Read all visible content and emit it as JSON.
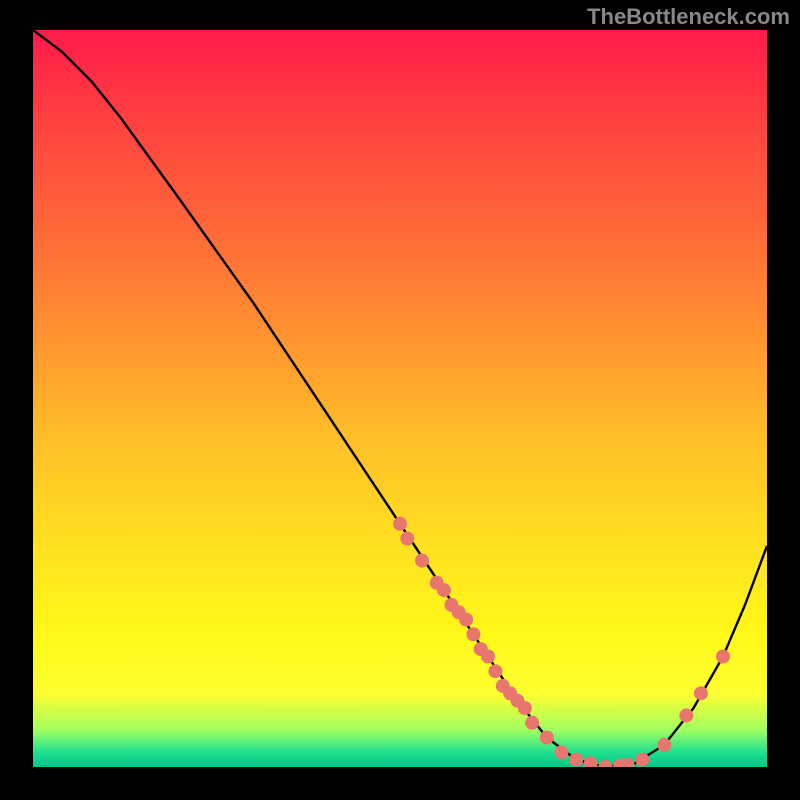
{
  "watermark": "TheBottleneck.com",
  "chart_data": {
    "type": "line",
    "title": "",
    "xlabel": "",
    "ylabel": "",
    "xlim": [
      0,
      100
    ],
    "ylim": [
      0,
      100
    ],
    "curve": {
      "x": [
        0,
        4,
        8,
        12,
        20,
        30,
        40,
        50,
        58,
        62,
        66,
        70,
        74,
        78,
        82,
        86,
        90,
        94,
        97,
        100
      ],
      "y": [
        100,
        97,
        93,
        88,
        77,
        63,
        48,
        33,
        21,
        15,
        9,
        4,
        1,
        0,
        0.5,
        3,
        8,
        15,
        22,
        30
      ]
    },
    "scatter_points": [
      {
        "x": 50,
        "y": 33
      },
      {
        "x": 51,
        "y": 31
      },
      {
        "x": 53,
        "y": 28
      },
      {
        "x": 55,
        "y": 25
      },
      {
        "x": 56,
        "y": 24
      },
      {
        "x": 57,
        "y": 22
      },
      {
        "x": 58,
        "y": 21
      },
      {
        "x": 59,
        "y": 20
      },
      {
        "x": 60,
        "y": 18
      },
      {
        "x": 61,
        "y": 16
      },
      {
        "x": 62,
        "y": 15
      },
      {
        "x": 63,
        "y": 13
      },
      {
        "x": 64,
        "y": 11
      },
      {
        "x": 65,
        "y": 10
      },
      {
        "x": 66,
        "y": 9
      },
      {
        "x": 67,
        "y": 8
      },
      {
        "x": 68,
        "y": 6
      },
      {
        "x": 70,
        "y": 4
      },
      {
        "x": 72,
        "y": 2
      },
      {
        "x": 74,
        "y": 1
      },
      {
        "x": 76,
        "y": 0.5
      },
      {
        "x": 78,
        "y": 0
      },
      {
        "x": 80,
        "y": 0.2
      },
      {
        "x": 81,
        "y": 0.3
      },
      {
        "x": 83,
        "y": 1
      },
      {
        "x": 86,
        "y": 3
      },
      {
        "x": 89,
        "y": 7
      },
      {
        "x": 91,
        "y": 10
      },
      {
        "x": 94,
        "y": 15
      }
    ],
    "point_color": "#e8766f",
    "curve_color": "#000000"
  }
}
